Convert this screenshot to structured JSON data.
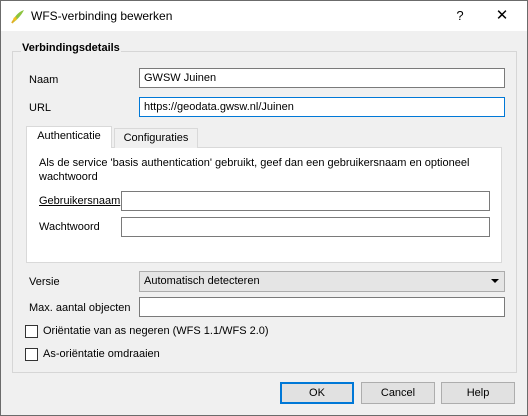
{
  "window": {
    "title": "WFS-verbinding bewerken",
    "help_glyph": "?",
    "close_glyph": "✕",
    "app_icon": "qgis-icon"
  },
  "group": {
    "title": "Verbindingsdetails"
  },
  "fields": {
    "name_label": "Naam",
    "name_value": "GWSW Juinen",
    "url_label": "URL",
    "url_value": "https://geodata.gwsw.nl/Juinen"
  },
  "tabs": [
    {
      "label": "Authenticatie",
      "active": true
    },
    {
      "label": "Configuraties",
      "active": false
    }
  ],
  "auth": {
    "info": "Als de service 'basis authentication' gebruikt, geef dan een gebruikersnaam en optioneel wachtwoord",
    "username_label": "Gebruikersnaam",
    "username_value": "",
    "password_label": "Wachtwoord",
    "password_value": ""
  },
  "version": {
    "label": "Versie",
    "selected": "Automatisch detecteren"
  },
  "max_features": {
    "label": "Max. aantal objecten",
    "value": ""
  },
  "checkboxes": {
    "ignore_axis_orientation": {
      "label": "Oriëntatie van as negeren (WFS 1.1/WFS 2.0)",
      "checked": false
    },
    "invert_axis_orientation": {
      "label": "As-oriëntatie omdraaien",
      "checked": false
    }
  },
  "buttons": {
    "ok": "OK",
    "cancel": "Cancel",
    "help": "Help"
  },
  "colors": {
    "focus_border": "#0078d7",
    "dialog_background": "#f0f0f0"
  }
}
